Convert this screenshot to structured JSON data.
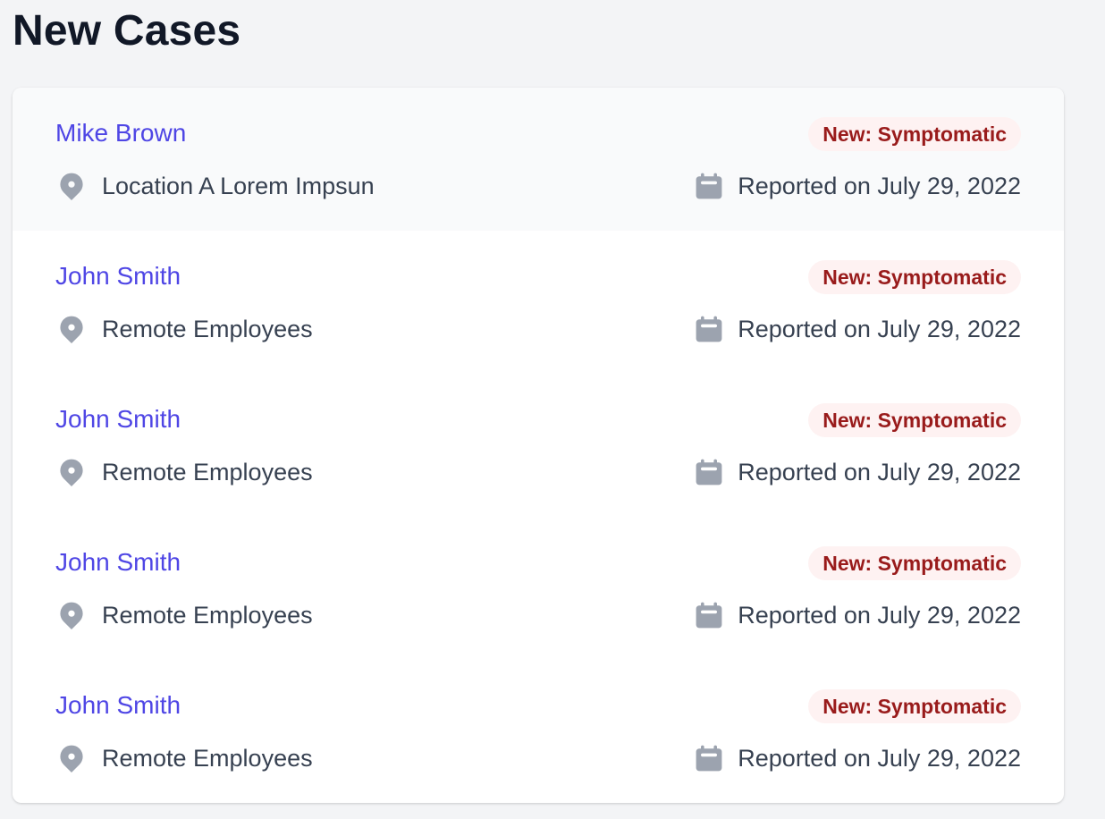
{
  "page": {
    "title": "New Cases"
  },
  "colors": {
    "name_link": "#4f46e5",
    "badge_bg": "#fef2f2",
    "badge_text": "#991b1b",
    "icon": "#9ca3af"
  },
  "cases": [
    {
      "name": "Mike Brown",
      "status": "New: Symptomatic",
      "location": "Location A Lorem Impsun",
      "location_icon": "map-pin-icon",
      "reported": "Reported on July 29, 2022",
      "reported_icon": "calendar-icon"
    },
    {
      "name": "John Smith",
      "status": "New: Symptomatic",
      "location": "Remote Employees",
      "location_icon": "map-pin-icon",
      "reported": "Reported on July 29, 2022",
      "reported_icon": "calendar-icon"
    },
    {
      "name": "John Smith",
      "status": "New: Symptomatic",
      "location": "Remote Employees",
      "location_icon": "map-pin-icon",
      "reported": "Reported on July 29, 2022",
      "reported_icon": "calendar-icon"
    },
    {
      "name": "John Smith",
      "status": "New: Symptomatic",
      "location": "Remote Employees",
      "location_icon": "map-pin-icon",
      "reported": "Reported on July 29, 2022",
      "reported_icon": "calendar-icon"
    },
    {
      "name": "John Smith",
      "status": "New: Symptomatic",
      "location": "Remote Employees",
      "location_icon": "map-pin-icon",
      "reported": "Reported on July 29, 2022",
      "reported_icon": "calendar-icon"
    }
  ]
}
